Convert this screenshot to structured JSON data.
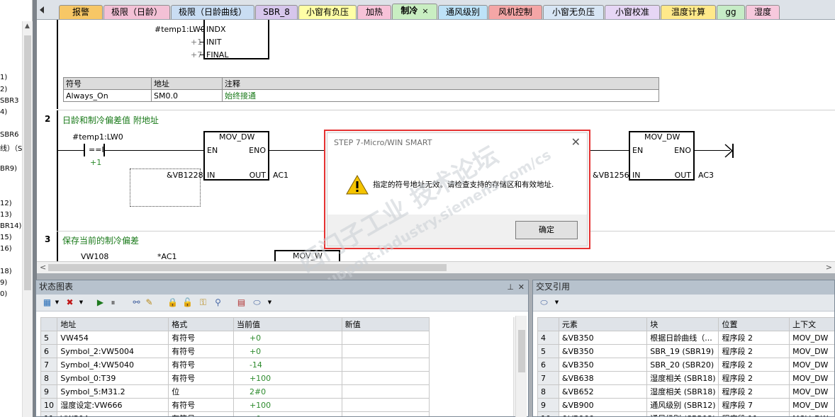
{
  "left_tree": {
    "items": [
      "1)",
      "2)",
      "SBR3",
      "4)",
      "SBR6",
      "线）（S",
      "BR9)",
      "12)",
      "13)",
      "BR14)",
      "15)",
      "16)",
      "18)",
      "9)",
      "0)"
    ]
  },
  "tabs": [
    {
      "label": "报警",
      "color": "#f7c766"
    },
    {
      "label": "极限（日龄）",
      "color": "#f3c1d6"
    },
    {
      "label": "极限（日龄曲线）",
      "color": "#c9ddf3"
    },
    {
      "label": "SBR_8",
      "color": "#d6c6ec"
    },
    {
      "label": "小窗有负压",
      "color": "#ffffa6"
    },
    {
      "label": "加热",
      "color": "#f7c2d8"
    },
    {
      "label": "制冷",
      "color": "#c9eec2",
      "active": true,
      "close": "×"
    },
    {
      "label": "通风级别",
      "color": "#bde2f7"
    },
    {
      "label": "风机控制",
      "color": "#f4a6a6"
    },
    {
      "label": "小窗无负压",
      "color": "#d8e6f5"
    },
    {
      "label": "小窗校准",
      "color": "#e6d6f5"
    },
    {
      "label": "温度计算",
      "color": "#ffe98a"
    },
    {
      "label": "gg",
      "color": "#c6ecc6"
    },
    {
      "label": "湿度",
      "color": "#f7c9dd"
    }
  ],
  "editor": {
    "net1": {
      "in_op": "#temp1:LW0",
      "pin_indx": "INDX",
      "pin_init": "INIT",
      "pin_final": "FINAL",
      "init_val": "+1",
      "final_val": "+7"
    },
    "sym_table": {
      "headers": [
        "符号",
        "地址",
        "注释"
      ],
      "rows": [
        [
          "Always_On",
          "SM0.0",
          "始终接通"
        ]
      ]
    },
    "net2": {
      "number": "2",
      "title": "日龄和制冷偏差值 附地址",
      "contact_op": "#temp1:LW0",
      "contact_sym": "==I",
      "contact_val": "+1",
      "box1": {
        "title": "MOV_DW",
        "en": "EN",
        "eno": "ENO",
        "in": "IN",
        "out": "OUT",
        "in_op": "&VB1228",
        "out_op": "AC1"
      },
      "box2": {
        "title": "MOV_DW",
        "en": "EN",
        "eno": "ENO",
        "in": "IN",
        "out": "OUT",
        "in_op": "&VB1256",
        "out_op": "AC3"
      }
    },
    "net3": {
      "number": "3",
      "title": "保存当前的制冷偏差",
      "op1": "VW108",
      "op2": "*AC1",
      "box_title": "MOV_W"
    }
  },
  "status_panel": {
    "title": "状态图表",
    "pin": "⊥",
    "close": "✕",
    "headers": [
      "",
      "地址",
      "格式",
      "当前值",
      "新值"
    ],
    "rows": [
      [
        "5",
        "VW454",
        "有符号",
        "+0",
        ""
      ],
      [
        "6",
        "Symbol_2:VW5004",
        "有符号",
        "+0",
        ""
      ],
      [
        "7",
        "Symbol_4:VW5040",
        "有符号",
        "-14",
        ""
      ],
      [
        "8",
        "Symbol_0:T39",
        "有符号",
        "+100",
        ""
      ],
      [
        "9",
        "Symbol_5:M31.2",
        "位",
        "2#0",
        ""
      ],
      [
        "10",
        "湿度设定:VW666",
        "有符号",
        "+100",
        ""
      ],
      [
        "11",
        "VW504",
        "有符号",
        "+0",
        ""
      ]
    ]
  },
  "xref_panel": {
    "title": "交叉引用",
    "headers": [
      "",
      "元素",
      "块",
      "位置",
      "上下文"
    ],
    "rows": [
      [
        "4",
        "&VB350",
        "根据日龄曲线（...",
        "程序段 2",
        "MOV_DW"
      ],
      [
        "5",
        "&VB350",
        "SBR_19 (SBR19)",
        "程序段 2",
        "MOV_DW"
      ],
      [
        "6",
        "&VB350",
        "SBR_20 (SBR20)",
        "程序段 2",
        "MOV_DW"
      ],
      [
        "7",
        "&VB638",
        "湿度相关 (SBR18)",
        "程序段 2",
        "MOV_DW"
      ],
      [
        "8",
        "&VB652",
        "湿度相关 (SBR18)",
        "程序段 2",
        "MOV_DW"
      ],
      [
        "9",
        "&VB900",
        "通风级别 (SBR12)",
        "程序段 7",
        "MOV_DW"
      ],
      [
        "10",
        "&VB966",
        "通风级别 (SBR12)",
        "程序段 11",
        "MOV_DW"
      ]
    ]
  },
  "dialog": {
    "title": "STEP 7-Micro/WIN SMART",
    "close": "✕",
    "message": "指定的符号地址无效。请检查支持的存储区和有效地址.",
    "ok": "确定"
  },
  "watermark": {
    "line1": "西门子工业 技术论坛",
    "line2": "support.industry.siemens.com/cs"
  },
  "colors": {
    "dialog_border": "#e53232",
    "comment_green": "#1a7a1a",
    "value_green": "#2e8b2e",
    "warning_yellow": "#f5c400"
  }
}
